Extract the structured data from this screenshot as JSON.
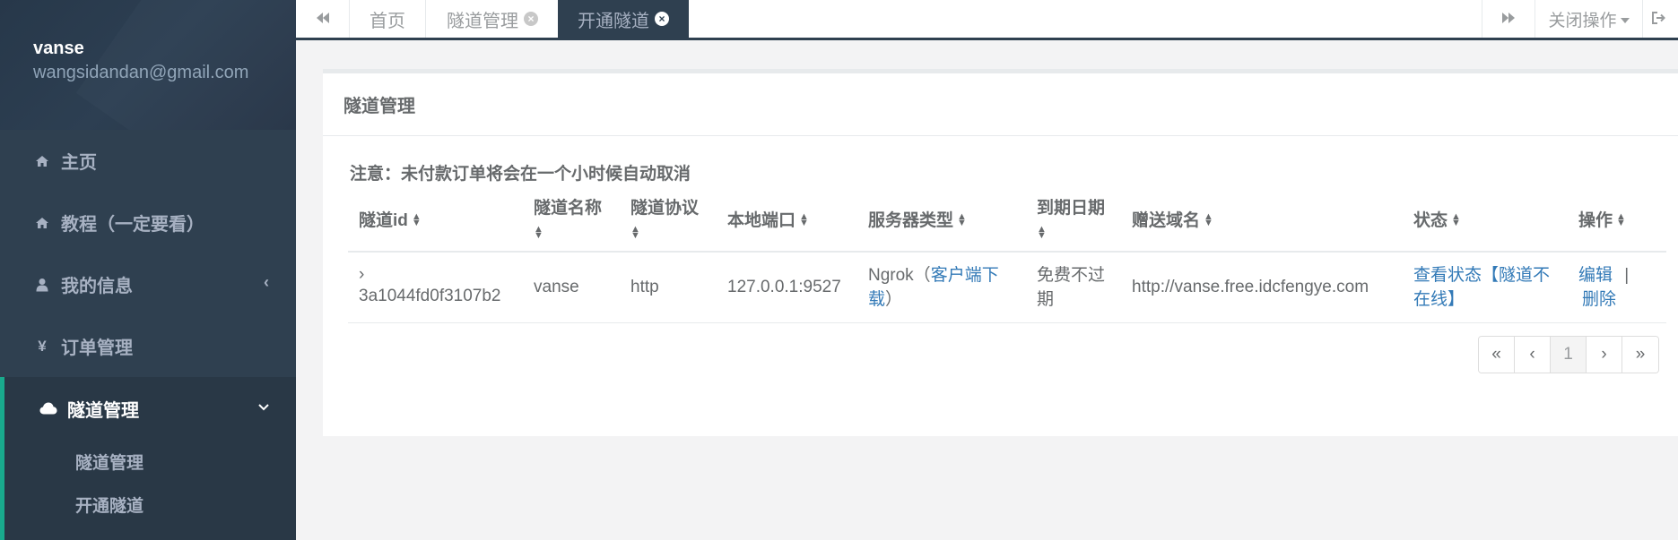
{
  "sidebar": {
    "username": "vanse",
    "email": "wangsidandan@gmail.com",
    "nav": [
      {
        "label": "主页",
        "icon": "home-icon"
      },
      {
        "label": "教程（一定要看）",
        "icon": "home-icon"
      },
      {
        "label": "我的信息",
        "icon": "user-icon"
      },
      {
        "label": "订单管理",
        "icon": "yen-icon"
      },
      {
        "label": "隧道管理",
        "icon": "cloud-icon"
      }
    ],
    "subnav": [
      "隧道管理",
      "开通隧道"
    ]
  },
  "tabbar": {
    "tabs": [
      {
        "label": "首页"
      },
      {
        "label": "隧道管理"
      },
      {
        "label": "开通隧道"
      }
    ],
    "close_ops": "关闭操作"
  },
  "panel": {
    "title": "隧道管理",
    "notice": "注意：未付款订单将会在一个小时候自动取消"
  },
  "table": {
    "columns": [
      "隧道id",
      "隧道名称",
      "隧道协议",
      "本地端口",
      "服务器类型",
      "到期日期",
      "赠送域名",
      "状态",
      "操作"
    ],
    "rows": [
      {
        "id": "3a1044fd0f3107b2",
        "name": "vanse",
        "protocol": "http",
        "local_port": "127.0.0.1:9527",
        "server_type": "Ngrok（",
        "server_link": "客户端下载",
        "server_suffix": "）",
        "expire": "免费不过期",
        "domain": "http://vanse.free.idcfengye.com",
        "status_link": "查看状态【隧道不在线】",
        "edit": "编辑",
        "sep": "|",
        "delete": "删除"
      }
    ]
  },
  "pagination": {
    "first": "«",
    "prev": "‹",
    "current": "1",
    "next": "›",
    "last": "»"
  },
  "colors": {
    "sidebar_bg": "#2f4050",
    "accent": "#19aa8d",
    "link": "#337ab7"
  }
}
